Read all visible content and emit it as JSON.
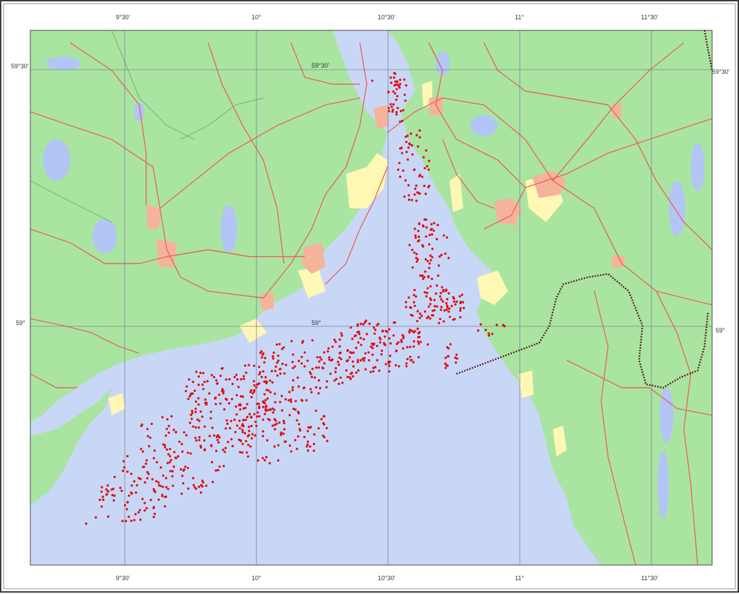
{
  "map": {
    "top_ticks": [
      "9°30'",
      "10°",
      "10°30'",
      "11°",
      "11°30'"
    ],
    "bottom_ticks": [
      "9°30'",
      "10°",
      "10°30'",
      "11°",
      "11°30'"
    ],
    "left_ticks": [
      "59°30'",
      "59°"
    ],
    "right_ticks": [
      "59°30'",
      "59°"
    ],
    "inner_labels": [
      "59°30'",
      "59°"
    ],
    "colors": {
      "sea": "#c9d7f7",
      "land": "#a9e5a1",
      "urban": "#f6b39b",
      "suburb": "#fff7b4",
      "road": "#e8665c",
      "grid": "#7d7d9a",
      "observation": "#e01010",
      "border": "#5a1c14"
    },
    "observation_marker": "red-dot",
    "observation_count_displayed": 1000
  }
}
